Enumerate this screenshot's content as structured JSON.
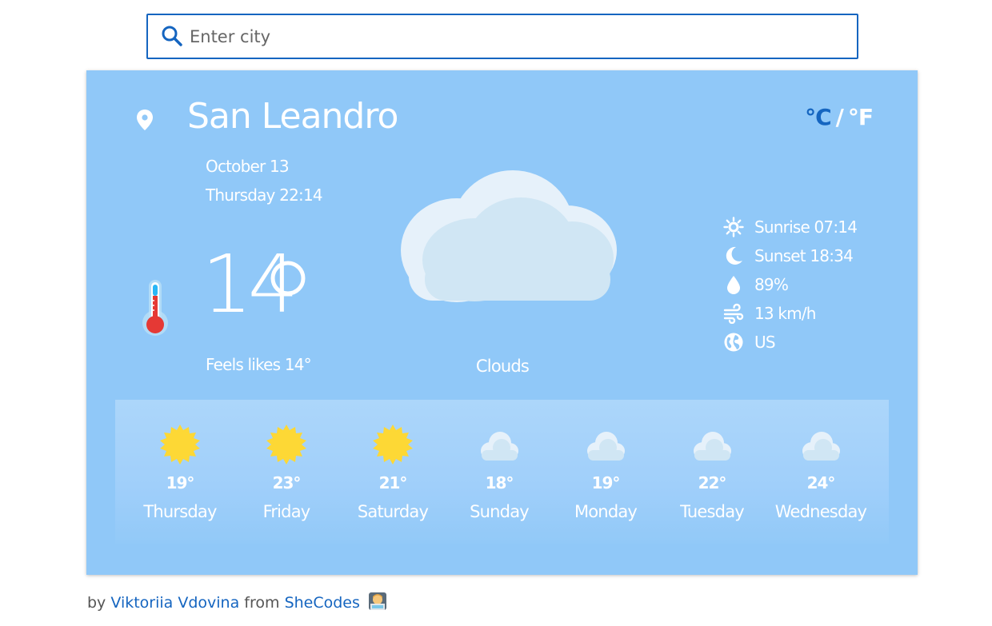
{
  "search": {
    "placeholder": "Enter city",
    "value": ""
  },
  "location": {
    "city": "San Leandro"
  },
  "units": {
    "celsius": "°C",
    "separator": "/",
    "fahrenheit": "°F",
    "active": "celsius"
  },
  "datetime": {
    "date": "October 13",
    "day_time": "Thursday 22:14"
  },
  "current": {
    "temperature": "14",
    "feels_like": "Feels likes 14°",
    "description": "Clouds",
    "icon": "cloud-icon"
  },
  "details": [
    {
      "icon": "sun-icon",
      "text": "Sunrise 07:14"
    },
    {
      "icon": "moon-icon",
      "text": "Sunset 18:34"
    },
    {
      "icon": "droplet-icon",
      "text": "89%"
    },
    {
      "icon": "wind-icon",
      "text": "13 km/h"
    },
    {
      "icon": "globe-icon",
      "text": "US"
    }
  ],
  "forecast": [
    {
      "day": "Thursday",
      "temp": "19°",
      "icon": "sun-icon"
    },
    {
      "day": "Friday",
      "temp": "23°",
      "icon": "sun-icon"
    },
    {
      "day": "Saturday",
      "temp": "21°",
      "icon": "sun-icon"
    },
    {
      "day": "Sunday",
      "temp": "18°",
      "icon": "cloud-icon"
    },
    {
      "day": "Monday",
      "temp": "19°",
      "icon": "cloud-icon"
    },
    {
      "day": "Tuesday",
      "temp": "22°",
      "icon": "cloud-icon"
    },
    {
      "day": "Wednesday",
      "temp": "24°",
      "icon": "cloud-icon"
    }
  ],
  "footer": {
    "prefix": "by",
    "author": "Viktoriia Vdovina",
    "middle": "from",
    "org": "SheCodes"
  },
  "colors": {
    "card_bg": "#90c8f8",
    "accent": "#1565c0",
    "sun": "#fdd835",
    "cloud": "#d4e8f5"
  }
}
